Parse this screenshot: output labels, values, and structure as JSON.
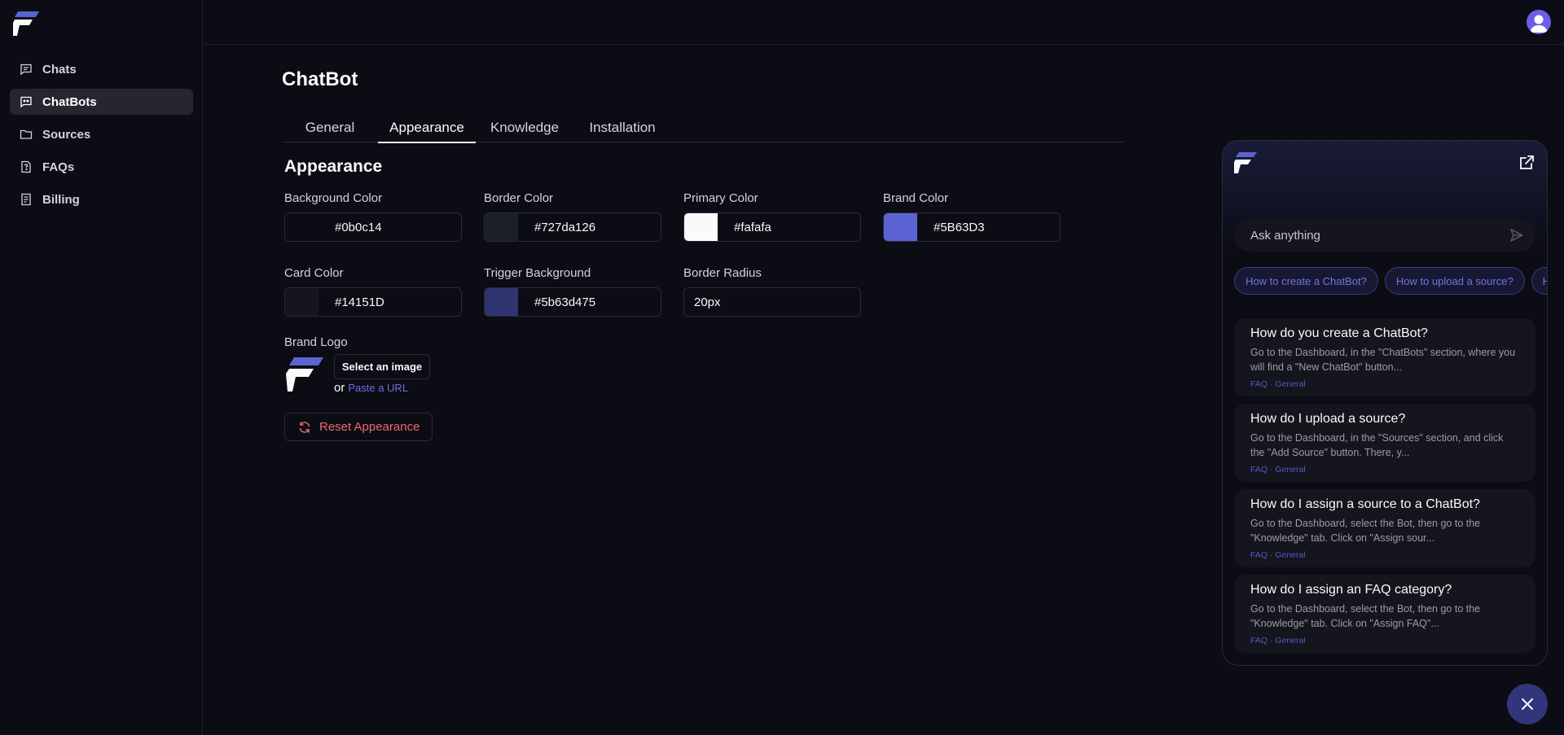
{
  "sidebar": {
    "items": [
      {
        "label": "Chats",
        "icon": "message-square-icon"
      },
      {
        "label": "ChatBots",
        "icon": "bot-message-icon",
        "active": true
      },
      {
        "label": "Sources",
        "icon": "folder-icon"
      },
      {
        "label": "FAQs",
        "icon": "file-question-icon"
      },
      {
        "label": "Billing",
        "icon": "receipt-icon"
      }
    ]
  },
  "header": {
    "avatar_icon": "user-avatar-icon"
  },
  "main": {
    "title": "ChatBot",
    "tabs": [
      {
        "label": "General"
      },
      {
        "label": "Appearance",
        "active": true
      },
      {
        "label": "Knowledge"
      },
      {
        "label": "Installation"
      }
    ],
    "section_title": "Appearance",
    "fields": {
      "background_color": {
        "label": "Background Color",
        "value": "#0b0c14",
        "swatch": "#0b0c14"
      },
      "border_color": {
        "label": "Border Color",
        "value": "#727da126",
        "swatch": "#1c1e2a"
      },
      "primary_color": {
        "label": "Primary Color",
        "value": "#fafafa",
        "swatch": "#fafafa"
      },
      "brand_color": {
        "label": "Brand Color",
        "value": "#5B63D3",
        "swatch": "#5B63D3"
      },
      "card_color": {
        "label": "Card Color",
        "value": "#14151D",
        "swatch": "#14151D"
      },
      "trigger_background": {
        "label": "Trigger Background",
        "value": "#5b63d475",
        "swatch": "#2f3470"
      },
      "border_radius": {
        "label": "Border Radius",
        "value": "20px"
      }
    },
    "brand_logo": {
      "label": "Brand Logo",
      "select_button": "Select an image",
      "or_text": "or",
      "paste_link": "Paste a URL"
    },
    "reset_button": "Reset Appearance"
  },
  "widget": {
    "input_placeholder": "Ask anything",
    "chips": [
      "How to create a ChatBot?",
      "How to upload a source?",
      "How do I assign a source?"
    ],
    "faqs": [
      {
        "title": "How do you create a ChatBot?",
        "body": "Go to the Dashboard, in the \"ChatBots\" section, where you will find a \"New ChatBot\" button...",
        "meta": "FAQ · General"
      },
      {
        "title": "How do I upload a source?",
        "body": "Go to the Dashboard, in the \"Sources\" section, and click the \"Add Source\" button. There, y...",
        "meta": "FAQ · General"
      },
      {
        "title": "How do I assign a source to a ChatBot?",
        "body": "Go to the Dashboard, select the Bot, then go to the \"Knowledge\" tab. Click on \"Assign sour...",
        "meta": "FAQ · General"
      },
      {
        "title": "How do I assign an FAQ category?",
        "body": "Go to the Dashboard, select the Bot, then go to the \"Knowledge\" tab. Click on \"Assign FAQ\"...",
        "meta": "FAQ · General"
      }
    ]
  },
  "colors": {
    "accent": "#5B63D3",
    "danger": "#ef6a6a",
    "background": "#0b0c14",
    "card": "#14151D"
  }
}
